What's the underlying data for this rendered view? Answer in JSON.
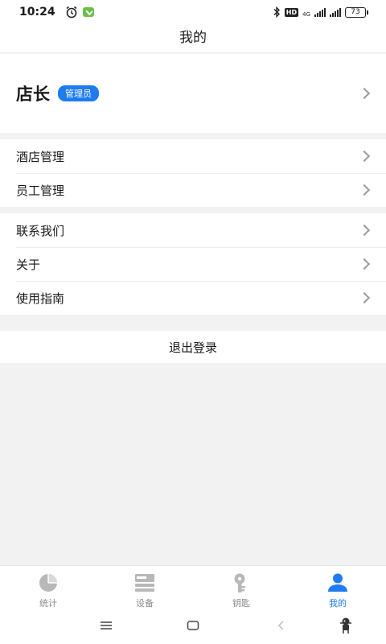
{
  "status": {
    "time": "10:24",
    "network": "4G",
    "battery": "73",
    "hd": "HD"
  },
  "header": {
    "title": "我的"
  },
  "profile": {
    "name": "店长",
    "role": "管理员"
  },
  "menu_groups": [
    {
      "items": [
        {
          "label": "酒店管理"
        },
        {
          "label": "员工管理"
        }
      ]
    },
    {
      "items": [
        {
          "label": "联系我们"
        },
        {
          "label": "关于"
        },
        {
          "label": "使用指南"
        }
      ]
    }
  ],
  "logout": {
    "label": "退出登录"
  },
  "tabs": [
    {
      "label": "统计",
      "icon": "pie-chart-icon"
    },
    {
      "label": "设备",
      "icon": "device-icon"
    },
    {
      "label": "钥匙",
      "icon": "key-icon"
    },
    {
      "label": "我的",
      "icon": "user-icon",
      "active": true
    }
  ],
  "colors": {
    "accent": "#1e7bf0",
    "inactive": "#8a8a8a",
    "background": "#f2f2f2"
  }
}
